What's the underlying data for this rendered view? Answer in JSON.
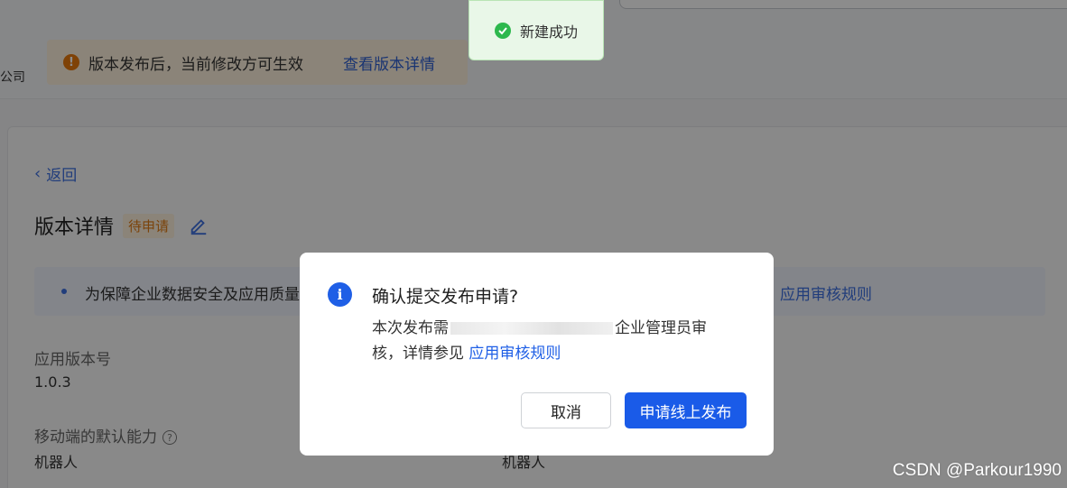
{
  "header": {
    "company_suffix": "公司",
    "banner": {
      "text": "版本发布后，当前修改方可生效",
      "link": "查看版本详情"
    }
  },
  "page": {
    "back_label": "返回",
    "title": "版本详情",
    "status_badge": "待申请",
    "info_text": "为保障企业数据安全及应用质量",
    "info_link": "应用审核规则"
  },
  "fields": {
    "version_label": "应用版本号",
    "version_value": "1.0.3",
    "mobile_label": "移动端的默认能力",
    "mobile_value": "机器人",
    "right_value": "机器人"
  },
  "toast": {
    "text": "新建成功"
  },
  "dialog": {
    "title": "确认提交发布申请?",
    "body_prefix": "本次发布需",
    "body_middle": "企业管理员审核，详情参见 ",
    "body_link": "应用审核规则",
    "cancel_label": "取消",
    "confirm_label": "申请线上发布"
  },
  "watermark": "CSDN @Parkour1990",
  "colors": {
    "primary": "#1a5be8",
    "success": "#2db84d",
    "warning": "#e8780c"
  }
}
